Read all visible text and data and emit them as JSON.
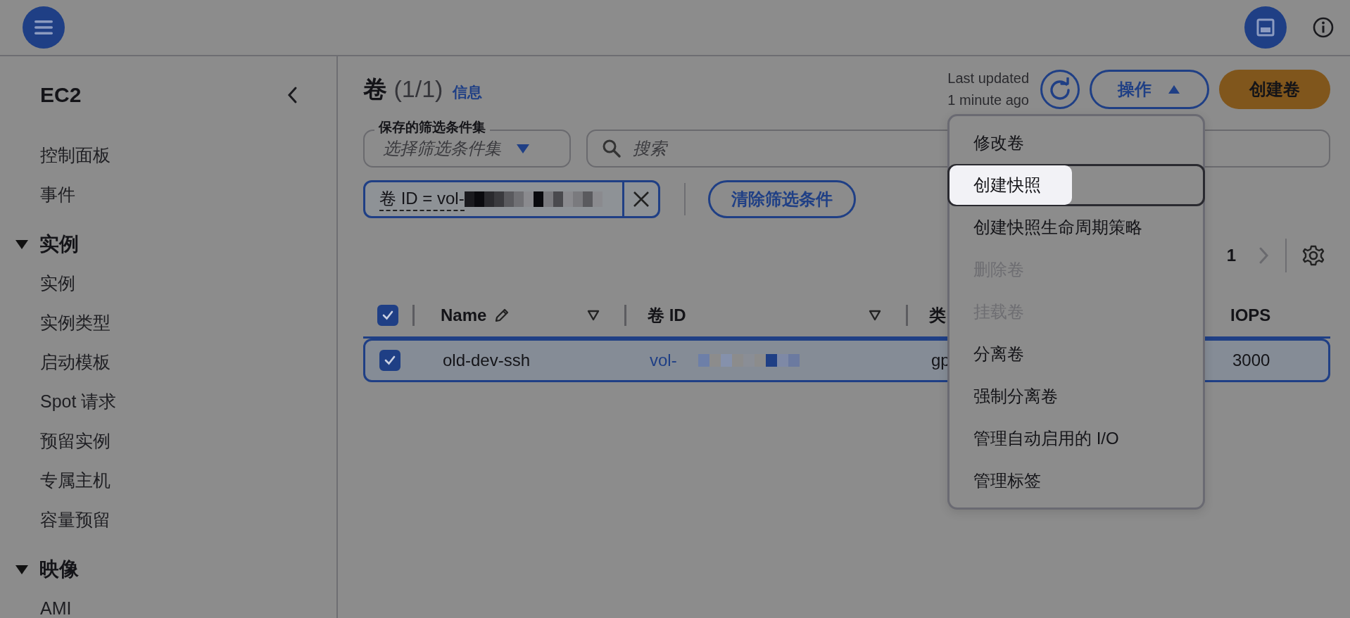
{
  "sidebar": {
    "title": "EC2",
    "groups": [
      {
        "items": [
          "控制面板",
          "事件"
        ]
      },
      {
        "title": "实例",
        "expanded": true,
        "items": [
          "实例",
          "实例类型",
          "启动模板",
          "Spot 请求",
          "预留实例",
          "专属主机",
          "容量预留"
        ]
      },
      {
        "title": "映像",
        "expanded": true,
        "items": [
          "AMI"
        ]
      }
    ]
  },
  "header": {
    "title": "卷",
    "count": "(1/1)",
    "info_link": "信息",
    "last_updated": [
      "Last updated",
      "1 minute ago"
    ],
    "actions_button": "操作",
    "create_button": "创建卷"
  },
  "saved_filter": {
    "label": "保存的筛选条件集",
    "placeholder": "选择筛选条件集"
  },
  "search": {
    "placeholder": "搜索"
  },
  "filter_token": {
    "text": "卷 ID = vol-"
  },
  "clear_filters_button": "清除筛选条件",
  "pagination": {
    "page": "1"
  },
  "table": {
    "all_checked": true,
    "columns": [
      "Name",
      "卷 ID",
      "类",
      "IOPS"
    ],
    "rows": [
      {
        "selected": true,
        "checked": true,
        "cells": [
          "old-dev-ssh",
          "vol-",
          "gp",
          "3000"
        ]
      }
    ]
  },
  "actions_menu": [
    {
      "label": "修改卷",
      "disabled": false,
      "selected": false
    },
    {
      "label": "创建快照",
      "disabled": false,
      "selected": true
    },
    {
      "label": "创建快照生命周期策略",
      "disabled": false,
      "selected": false
    },
    {
      "label": "删除卷",
      "disabled": true,
      "selected": false
    },
    {
      "label": "挂载卷",
      "disabled": true,
      "selected": false
    },
    {
      "label": "分离卷",
      "disabled": false,
      "selected": false
    },
    {
      "label": "强制分离卷",
      "disabled": false,
      "selected": false
    },
    {
      "label": "管理自动启用的 I/O",
      "disabled": false,
      "selected": false
    },
    {
      "label": "管理标签",
      "disabled": false,
      "selected": false
    }
  ]
}
